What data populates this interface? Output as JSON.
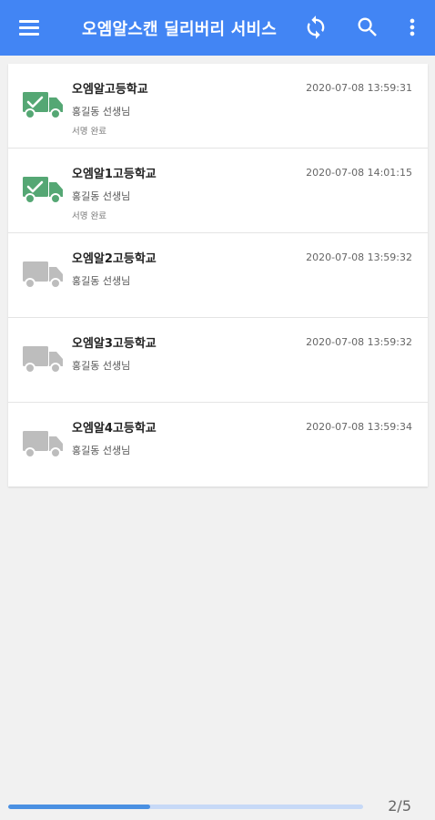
{
  "header": {
    "title": "오엠알스캔 딜리버리 서비스",
    "menu_icon": "hamburger-menu-icon",
    "actions": [
      "sync-icon",
      "search-icon",
      "more-vert-icon"
    ],
    "bg_color": "#4285f4"
  },
  "colors": {
    "delivered": "#55a774",
    "pending": "#bdbdbd"
  },
  "deliveries": [
    {
      "name": "오엠알고등학교",
      "teacher": "홍길동 선생님",
      "time": "2020-07-08 13:59:31",
      "status": "서명 완료",
      "delivered": true
    },
    {
      "name": "오엠알1고등학교",
      "teacher": "홍길동 선생님",
      "time": "2020-07-08 14:01:15",
      "status": "서명 완료",
      "delivered": true
    },
    {
      "name": "오엠알2고등학교",
      "teacher": "홍길동 선생님",
      "time": "2020-07-08 13:59:32",
      "status": "",
      "delivered": false
    },
    {
      "name": "오엠알3고등학교",
      "teacher": "홍길동 선생님",
      "time": "2020-07-08 13:59:32",
      "status": "",
      "delivered": false
    },
    {
      "name": "오엠알4고등학교",
      "teacher": "홍길동 선생님",
      "time": "2020-07-08 13:59:34",
      "status": "",
      "delivered": false
    }
  ],
  "footer": {
    "page_indicator": "2/5",
    "progress": 0.4
  }
}
